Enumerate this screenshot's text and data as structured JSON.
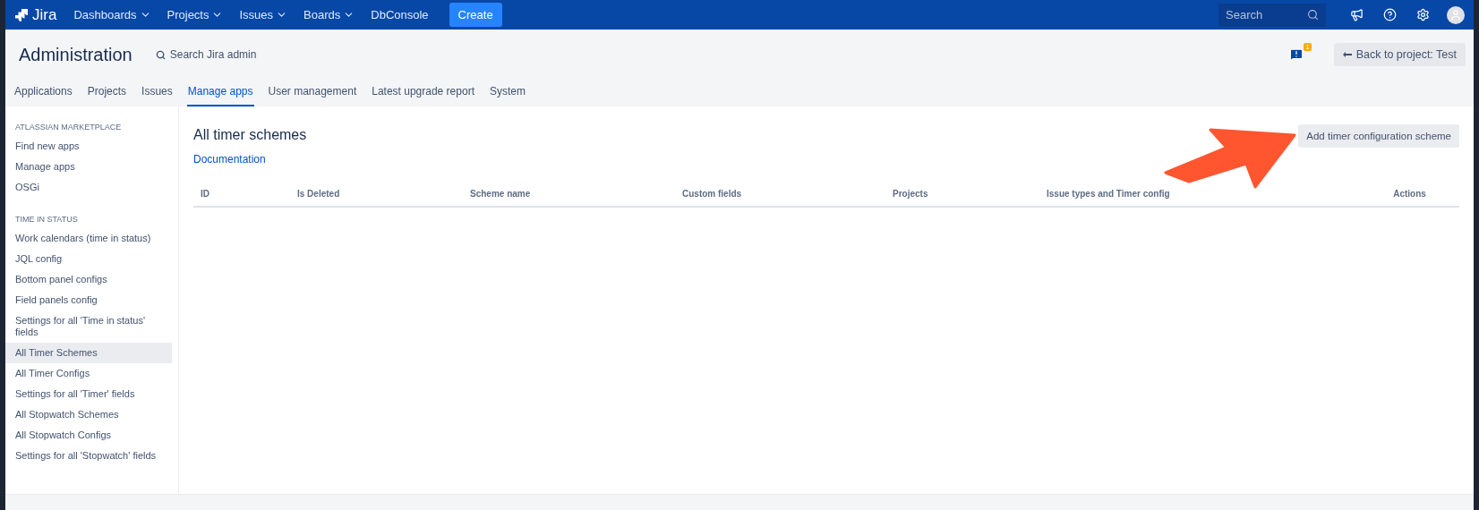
{
  "topbar": {
    "logo": "Jira",
    "nav": [
      {
        "label": "Dashboards",
        "kind": "dropdown"
      },
      {
        "label": "Projects",
        "kind": "dropdown"
      },
      {
        "label": "Issues",
        "kind": "dropdown"
      },
      {
        "label": "Boards",
        "kind": "dropdown"
      },
      {
        "label": "DbConsole",
        "kind": "link"
      }
    ],
    "create": "Create",
    "search": {
      "placeholder": "Search"
    }
  },
  "header": {
    "title": "Administration",
    "search_admin": "Search Jira admin",
    "notification_count": "1",
    "back_button": "Back to project: Test"
  },
  "tabs": [
    {
      "label": "Applications",
      "selected": false
    },
    {
      "label": "Projects",
      "selected": false
    },
    {
      "label": "Issues",
      "selected": false
    },
    {
      "label": "Manage apps",
      "selected": true
    },
    {
      "label": "User management",
      "selected": false
    },
    {
      "label": "Latest upgrade report",
      "selected": false
    },
    {
      "label": "System",
      "selected": false
    }
  ],
  "sidebar": {
    "sections": [
      {
        "heading": "ATLASSIAN MARKETPLACE",
        "items": [
          {
            "label": "Find new apps",
            "selected": false
          },
          {
            "label": "Manage apps",
            "selected": false
          },
          {
            "label": "OSGi",
            "selected": false
          }
        ]
      },
      {
        "heading": "TIME IN STATUS",
        "items": [
          {
            "label": "Work calendars (time in status)",
            "selected": false
          },
          {
            "label": "JQL config",
            "selected": false
          },
          {
            "label": "Bottom panel configs",
            "selected": false
          },
          {
            "label": "Field panels config",
            "selected": false
          },
          {
            "label": "Settings for all 'Time in status' fields",
            "selected": false
          },
          {
            "label": "All Timer Schemes",
            "selected": true
          },
          {
            "label": "All Timer Configs",
            "selected": false
          },
          {
            "label": "Settings for all 'Timer' fields",
            "selected": false
          },
          {
            "label": "All Stopwatch Schemes",
            "selected": false
          },
          {
            "label": "All Stopwatch Configs",
            "selected": false
          },
          {
            "label": "Settings for all 'Stopwatch' fields",
            "selected": false
          }
        ]
      }
    ]
  },
  "main": {
    "title": "All timer schemes",
    "link": "Documentation",
    "add_button": "Add timer configuration scheme",
    "table": {
      "columns": [
        "ID",
        "Is Deleted",
        "Scheme name",
        "Custom fields",
        "Projects",
        "Issue types and Timer config",
        "Actions"
      ]
    }
  }
}
